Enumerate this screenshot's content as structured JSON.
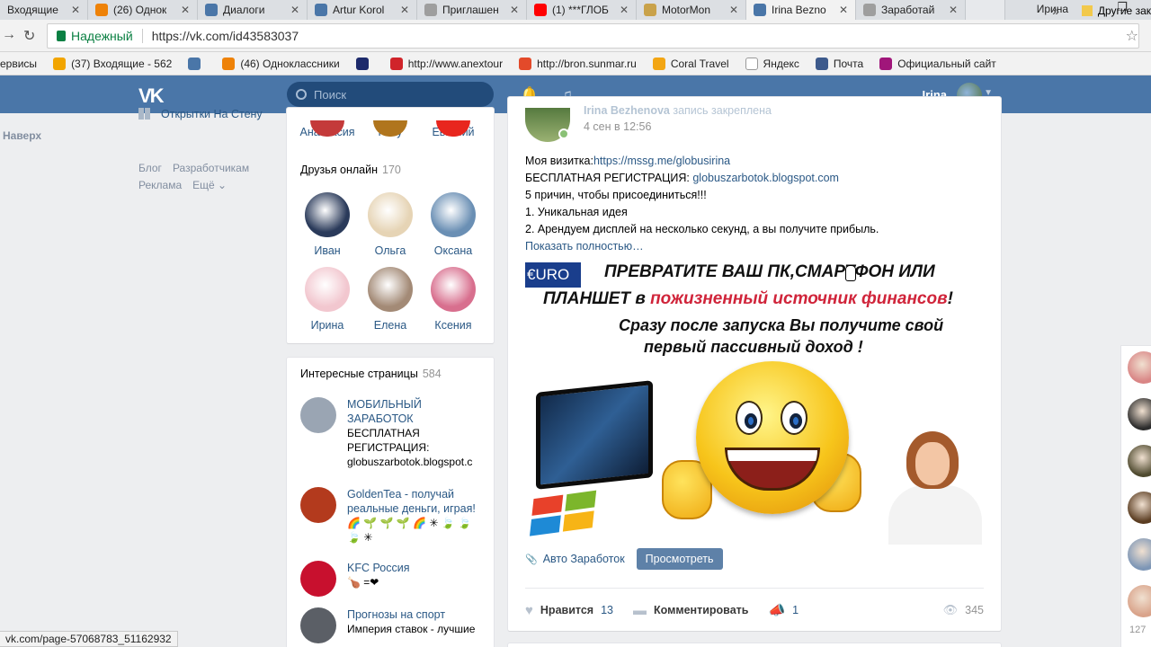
{
  "browser": {
    "tabs": [
      {
        "label": "Входящие",
        "icon_color": "#dfe3e7"
      },
      {
        "label": "(26) Однок",
        "icon_color": "#ee8208"
      },
      {
        "label": "Диалоги",
        "icon_color": "#4a76a8"
      },
      {
        "label": "Artur Korol",
        "icon_color": "#4a76a8"
      },
      {
        "label": "Приглашен",
        "icon_color": "#9e9e9e"
      },
      {
        "label": "(1) ***ГЛОБ",
        "icon_color": "#ff0000"
      },
      {
        "label": "MotorMon",
        "icon_color": "#c9a24a"
      },
      {
        "label": "Irina Bezno",
        "icon_color": "#4a76a8"
      },
      {
        "label": "Заработай",
        "icon_color": "#9e9e9e"
      }
    ],
    "window_user": "Ирина",
    "secure_label": "Надежный",
    "url": "https://vk.com/id43583037",
    "bookmarks": [
      {
        "label": "ервисы",
        "icon_color": ""
      },
      {
        "label": "(37) Входящие - 562",
        "icon_color": "#f2a500"
      },
      {
        "label": "",
        "icon_color": "#4a76a8"
      },
      {
        "label": "(46) Одноклассники",
        "icon_color": "#ee8208"
      },
      {
        "label": "",
        "icon_color": "#1d2a6b"
      },
      {
        "label": "http://www.anextour",
        "icon_color": "#d0242a"
      },
      {
        "label": "http://bron.sunmar.ru",
        "icon_color": "#e34a2a"
      },
      {
        "label": "Coral Travel",
        "icon_color": "#f3a614"
      },
      {
        "label": "Яндекс",
        "icon_color": "#ffffff"
      },
      {
        "label": "Почта",
        "icon_color": "#3d5a8c"
      },
      {
        "label": "Официальный сайт",
        "icon_color": "#a0167a"
      }
    ],
    "bookmarks_more": "»",
    "other_bookmarks": "Другие зак",
    "status_url": "vk.com/page-57068783_51162932"
  },
  "vk": {
    "logo": "VK",
    "search_placeholder": "Поиск",
    "user_name": "Irina",
    "colors": {
      "header": "#4a76a8",
      "link": "#2a5885",
      "muted": "#939393"
    }
  },
  "left_nav": {
    "greetings_item": "Открытки На Стену",
    "up_link": "Наверх",
    "footer": [
      "Блог",
      "Разработчикам",
      "Реклама",
      "Ещё ⌄"
    ]
  },
  "friends": {
    "top_row": [
      {
        "name": "Анастасия",
        "color": "#c43a3a"
      },
      {
        "name": "Keily",
        "color": "#b0751d"
      },
      {
        "name": "Евгений",
        "color": "#e8261e"
      }
    ],
    "online_title": "Друзья онлайн",
    "online_count": "170",
    "online": [
      {
        "name": "Иван",
        "color": "#2a3a5a"
      },
      {
        "name": "Ольга",
        "color": "#e6d4b5"
      },
      {
        "name": "Оксана",
        "color": "#6a8fb4"
      },
      {
        "name": "Ирина",
        "color": "#f2c7cf"
      },
      {
        "name": "Елена",
        "color": "#a38a76"
      },
      {
        "name": "Ксения",
        "color": "#d86f8e"
      }
    ]
  },
  "pages": {
    "title": "Интересные страницы",
    "count": "584",
    "items": [
      {
        "title": "МОБИЛЬНЫЙ ЗАРАБОТОК",
        "sub": "БЕСПЛАТНАЯ РЕГИСТРАЦИЯ: globuszarbotok.blogspot.c",
        "color": "#9aa5b3"
      },
      {
        "title": "GoldenTea - получай реальные деньги, играя!",
        "sub": "🌈 🌱 🌱 🌱 🌈 ✳ 🍃 🍃 🍃 ✳",
        "color": "#b33a1d"
      },
      {
        "title": "KFC Россия",
        "sub": "🍗 =❤",
        "color": "#c8102e"
      },
      {
        "title": "Прогнозы на спорт",
        "sub": "Империя ставок - лучшие ... дело",
        "color": "#5b5f66"
      }
    ]
  },
  "post": {
    "author": "Irina Bezhenova",
    "pinned": "запись закреплена",
    "date": "4 сен в 12:56",
    "card_label": "Моя визитка:",
    "card_link": "https://mssg.me/globusirina",
    "reg_label": "БЕСПЛАТНАЯ РЕГИСТРАЦИЯ:",
    "reg_link": "globuszarbotok.blogspot.com",
    "line3": "5 причин, чтобы присоединиться!!!",
    "line4": "1. Уникальная идея",
    "line5": "2. Арендуем дисплей на несколько секунд, а вы получите прибыль.",
    "show_more": "Показать полностью…",
    "promo": {
      "badge": "€URO",
      "line1": "ПРЕВРАТИТЕ ВАШ ПК,СМАРТФОН ИЛИ",
      "line2a": "ПЛАНШЕТ в ",
      "line2b": "пожизненный источник финансов",
      "line2c": "!",
      "line3": "Сразу после запуска Вы получите свой",
      "line4": "первый пассивный доход !"
    },
    "attachment": "Авто Заработок",
    "view_button": "Просмотреть",
    "like_label": "Нравится",
    "likes": "13",
    "comment_label": "Комментировать",
    "shares": "1",
    "views": "345"
  },
  "right_strip": {
    "count": "127",
    "avatar_colors": [
      "#d98585",
      "#2d2d2d",
      "#4f4a2f",
      "#5b3d22",
      "#7d96b6",
      "#d9a38a"
    ]
  }
}
